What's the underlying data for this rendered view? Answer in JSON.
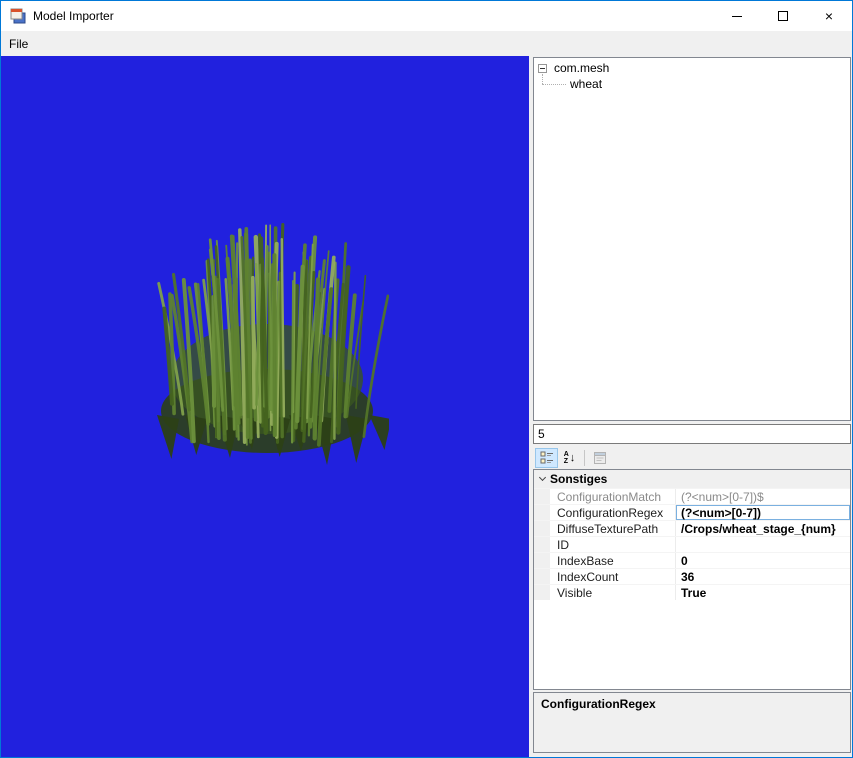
{
  "window": {
    "title": "Model Importer"
  },
  "icons": {
    "close": "×",
    "sort_arrow": "↓",
    "az_a": "A",
    "az_z": "Z"
  },
  "menu": {
    "file": "File"
  },
  "viewport": {
    "background": "#2121de",
    "grass_palette": [
      "#2c4016",
      "#3a5520",
      "#44631f",
      "#527428",
      "#5e8230",
      "#6d913c",
      "#7fa04a",
      "#93ad5c"
    ]
  },
  "tree": {
    "root_label": "com.mesh",
    "child_label": "wheat"
  },
  "stage_box": {
    "value": "5"
  },
  "property_grid": {
    "category": "Sonstiges",
    "rows": [
      {
        "name": "ConfigurationMatch",
        "value": "(?<num>[0-7])$",
        "state": "readonly"
      },
      {
        "name": "ConfigurationRegex",
        "value": "(?<num>[0-7])",
        "state": "modified",
        "selected": true
      },
      {
        "name": "DiffuseTexturePath",
        "value": "/Crops/wheat_stage_{num}",
        "state": "modified"
      },
      {
        "name": "ID",
        "value": "",
        "state": "normal"
      },
      {
        "name": "IndexBase",
        "value": "0",
        "state": "modified"
      },
      {
        "name": "IndexCount",
        "value": "36",
        "state": "modified"
      },
      {
        "name": "Visible",
        "value": "True",
        "state": "modified"
      }
    ],
    "description_title": "ConfigurationRegex"
  }
}
